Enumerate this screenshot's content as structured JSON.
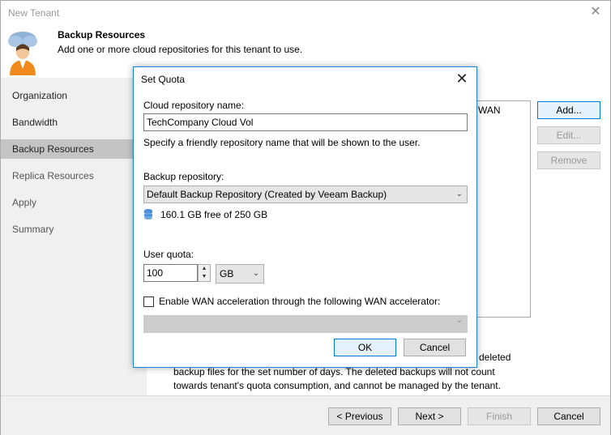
{
  "window": {
    "title": "New Tenant"
  },
  "header": {
    "title": "Backup Resources",
    "subtitle": "Add one or more cloud repositories for this tenant to use."
  },
  "sidebar": {
    "items": [
      {
        "label": "Organization"
      },
      {
        "label": "Bandwidth"
      },
      {
        "label": "Backup Resources"
      },
      {
        "label": "Replica Resources"
      },
      {
        "label": "Apply"
      },
      {
        "label": "Summary"
      }
    ]
  },
  "content": {
    "list_partial": "WAN",
    "add_label": "Add...",
    "edit_label": "Edit...",
    "remove_label": "Remove",
    "note_head": "deleted",
    "note_line1": "backup files for the set number of days. The deleted backups will not count",
    "note_line2": "towards tenant's quota consumption, and cannot be managed by the tenant."
  },
  "dialog": {
    "title": "Set Quota",
    "name_label": "Cloud repository name:",
    "name_value": "TechCompany Cloud Vol",
    "name_hint": "Specify a friendly repository name that will be shown to the user.",
    "repo_label": "Backup repository:",
    "repo_value": "Default Backup Repository (Created by Veeam Backup)",
    "free_space": "160.1 GB free of 250 GB",
    "quota_label": "User quota:",
    "quota_value": "100",
    "quota_unit": "GB",
    "wan_checkbox_label": "Enable WAN acceleration through the following WAN accelerator:",
    "wan_value": "",
    "ok_label": "OK",
    "cancel_label": "Cancel"
  },
  "footer": {
    "previous_label": "< Previous",
    "next_label": "Next >",
    "finish_label": "Finish",
    "cancel_label": "Cancel"
  },
  "colors": {
    "accent": "#0078d7",
    "sidebar_bg": "#f0f0f0",
    "sidebar_active": "#c4c4c4"
  }
}
